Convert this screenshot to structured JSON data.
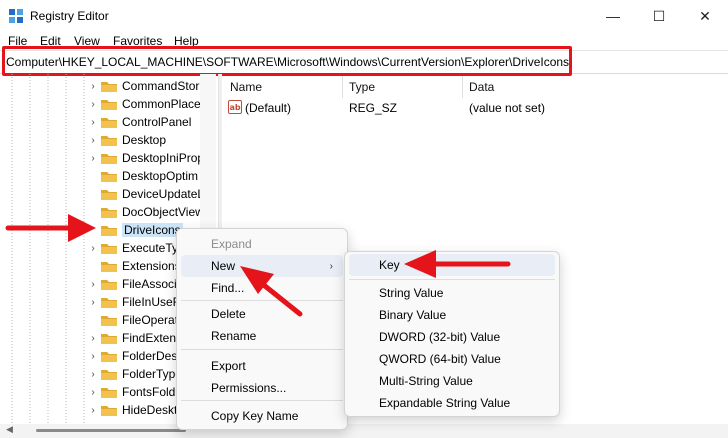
{
  "window": {
    "title": "Registry Editor",
    "minimize_glyph": "—",
    "maximize_glyph": "☐",
    "close_glyph": "✕"
  },
  "menu": [
    "File",
    "Edit",
    "View",
    "Favorites",
    "Help"
  ],
  "address": {
    "path": "Computer\\HKEY_LOCAL_MACHINE\\SOFTWARE\\Microsoft\\Windows\\CurrentVersion\\Explorer\\DriveIcons"
  },
  "tree": {
    "items": [
      {
        "label": "CommandStor",
        "expandable": true
      },
      {
        "label": "CommonPlace",
        "expandable": true
      },
      {
        "label": "ControlPanel",
        "expandable": true
      },
      {
        "label": "Desktop",
        "expandable": true
      },
      {
        "label": "DesktopIniProp",
        "expandable": true
      },
      {
        "label": "DesktopOptim",
        "expandable": false
      },
      {
        "label": "DeviceUpdateL",
        "expandable": false
      },
      {
        "label": "DocObjectView",
        "expandable": false
      },
      {
        "label": "DriveIcons",
        "expandable": false,
        "selected": true
      },
      {
        "label": "ExecuteTy",
        "expandable": true
      },
      {
        "label": "Extensions",
        "expandable": false
      },
      {
        "label": "FileAssoci",
        "expandable": true
      },
      {
        "label": "FileInUseR",
        "expandable": true
      },
      {
        "label": "FileOperat",
        "expandable": false
      },
      {
        "label": "FindExtens",
        "expandable": true
      },
      {
        "label": "FolderDesc",
        "expandable": true
      },
      {
        "label": "FolderType",
        "expandable": true
      },
      {
        "label": "FontsFold",
        "expandable": true
      },
      {
        "label": "HideDeskto",
        "expandable": true
      }
    ]
  },
  "values_pane": {
    "columns": [
      "Name",
      "Type",
      "Data"
    ],
    "rows": [
      {
        "name": "(Default)",
        "type": "REG_SZ",
        "data": "(value not set)",
        "icon": "string-value-icon"
      }
    ]
  },
  "context_menu": {
    "items": [
      {
        "label": "Expand",
        "disabled": true
      },
      {
        "label": "New",
        "submenu": true,
        "hover": true
      },
      {
        "label": "Find..."
      },
      {
        "label": "Delete"
      },
      {
        "label": "Rename"
      },
      {
        "label": "Export"
      },
      {
        "label": "Permissions..."
      },
      {
        "label": "Copy Key Name"
      }
    ],
    "submenu_arrow": "›"
  },
  "submenu": {
    "items": [
      {
        "label": "Key",
        "hover": true
      },
      {
        "label": "String Value"
      },
      {
        "label": "Binary Value"
      },
      {
        "label": "DWORD (32-bit) Value"
      },
      {
        "label": "QWORD (64-bit) Value"
      },
      {
        "label": "Multi-String Value"
      },
      {
        "label": "Expandable String Value"
      }
    ]
  },
  "colors": {
    "annotation_red": "#e5141b",
    "folder_yellow": "#f2c14e",
    "selection_blue": "#cce4f7"
  }
}
